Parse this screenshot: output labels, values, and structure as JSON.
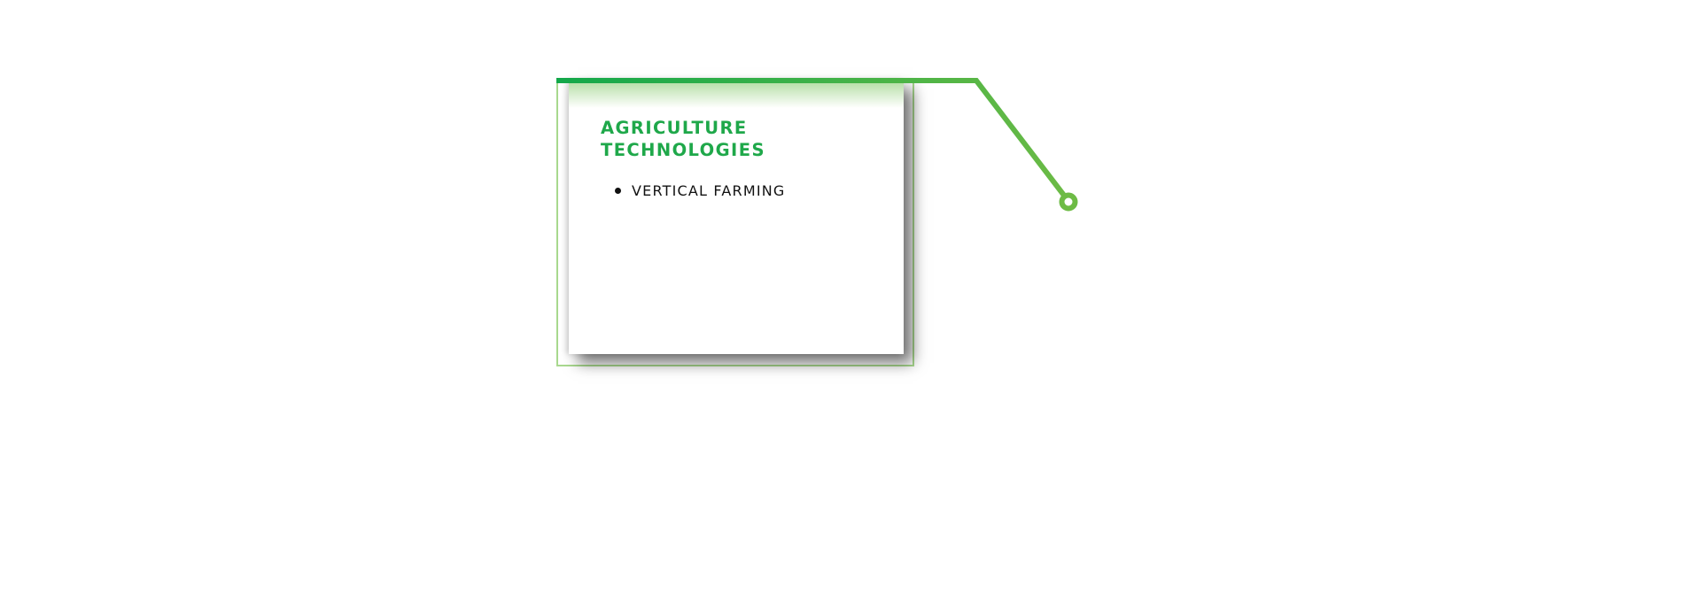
{
  "card": {
    "title": "AGRICULTURE\nTECHNOLOGIES",
    "items": [
      {
        "label": "VERTICAL FARMING"
      }
    ]
  },
  "colors": {
    "title_green": "#1fa84a",
    "connector_start": "#13a84a",
    "connector_end": "#6dbb45",
    "frame": "#a9d98f"
  },
  "icons": {
    "connector_end": "ring-node-icon"
  }
}
